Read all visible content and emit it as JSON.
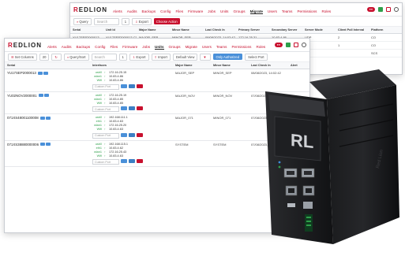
{
  "app": {
    "logo_text": "EDLION",
    "logo_prefix": "R"
  },
  "back_window": {
    "nav": [
      "Alerts",
      "Audits",
      "Backups",
      "Config",
      "Files",
      "Firmware",
      "Jobs",
      "Units",
      "Groups",
      "Migrate",
      "Users",
      "Teams",
      "Permissions",
      "Roles"
    ],
    "active_nav": "Migrate",
    "toolbar": {
      "query_label": "Query",
      "search_placeholder": "Search",
      "page_value": "1",
      "export_label": "Export",
      "choose_label": "Choose Action"
    },
    "columns": [
      "Serial",
      "Unit Id",
      "Major Name",
      "Minor Name",
      "Last Check In",
      "Primary Server",
      "Secondary Server",
      "Server Mode",
      "Client Poll Interval",
      "Platform"
    ],
    "rows": [
      {
        "serial": "YU17SEP2000013",
        "unit_id": "YU17SEP2000013-C03",
        "major": "MAJOR_SEP",
        "minor": "MINOR_SEP",
        "checkin": "08/08/2023, 14:02:42",
        "primary": "172.16.25.31",
        "secondary": "10.83.4.86",
        "mode": "UDP",
        "poll": "2",
        "platform": "CO"
      },
      {
        "serial": "",
        "unit_id": "",
        "major": "",
        "minor": "",
        "checkin": "",
        "primary": "",
        "secondary": "",
        "mode": "",
        "poll": "1",
        "platform": "CO"
      },
      {
        "serial": "",
        "unit_id": "",
        "major": "",
        "minor": "",
        "checkin": "",
        "primary": "",
        "secondary": "",
        "mode": "",
        "poll": "",
        "platform": "SCS"
      }
    ]
  },
  "front_window": {
    "nav": [
      "Alerts",
      "Audits",
      "Backups",
      "Config",
      "Files",
      "Firmware",
      "Jobs",
      "Units",
      "Groups",
      "Migrate",
      "Users",
      "Teams",
      "Permissions",
      "Roles"
    ],
    "active_nav": "Units",
    "toolbar": {
      "set_columns_label": "Set Columns",
      "page_size": "20",
      "query_sort_label": "Query/Sort",
      "search_placeholder": "Search",
      "page_value": "1",
      "export_label": "Export",
      "import_label": "Import",
      "view_label": "Default View",
      "only_authorized_label": "Only Authorized",
      "select_port_label": "Select Port"
    },
    "columns": [
      "Serial",
      "Interfaces",
      "Major Name",
      "Minor Name",
      "Last Check In",
      "Alert"
    ],
    "custom_port_placeholder": "Custom Port",
    "units": [
      {
        "serial": "YU17SEP2000013",
        "major": "MAJOR_SEP",
        "minor": "MINOR_SEP",
        "checkin": "08/08/2023, 14:02:42",
        "ifaces": [
          {
            "name": "usb0",
            "ip": "172.16.25.15"
          },
          {
            "name": "wlan1",
            "ip": "10.83.4.86"
          },
          {
            "name": "Wifi",
            "ip": "10.83.4.86"
          }
        ]
      },
      {
        "serial": "YU02NOV2000001",
        "major": "MAJOR_NOV",
        "minor": "MINOR_NOV",
        "checkin": "07/08/2023,",
        "ifaces": [
          {
            "name": "usb0",
            "ip": "172.16.25.19"
          },
          {
            "name": "wlan1",
            "ip": "10.83.4.85"
          },
          {
            "name": "Wifi",
            "ip": "10.83.4.85"
          }
        ]
      },
      {
        "serial": "071XS48001100008",
        "major": "MAJOR_071",
        "minor": "MINOR_071",
        "checkin": "07/08/2023,",
        "ifaces": [
          {
            "name": "usb0",
            "ip": "192.168.111.1"
          },
          {
            "name": "eth1",
            "ip": "10.83.4.63"
          },
          {
            "name": "wlan1",
            "ip": "172.16.25.20"
          },
          {
            "name": "Wifi",
            "ip": "10.83.4.63"
          }
        ]
      },
      {
        "serial": "071XS38880000006",
        "major": "SYSTEM",
        "minor": "SYSTEM",
        "checkin": "07/08/2023,",
        "ifaces": [
          {
            "name": "usb0",
            "ip": "192.168.115.1"
          },
          {
            "name": "eth1",
            "ip": "10.83.4.62"
          },
          {
            "name": "wlan1",
            "ip": "172.16.25.43"
          },
          {
            "name": "Wifi",
            "ip": "10.83.4.63"
          }
        ]
      }
    ]
  },
  "device": {
    "brand_text": "RL"
  }
}
